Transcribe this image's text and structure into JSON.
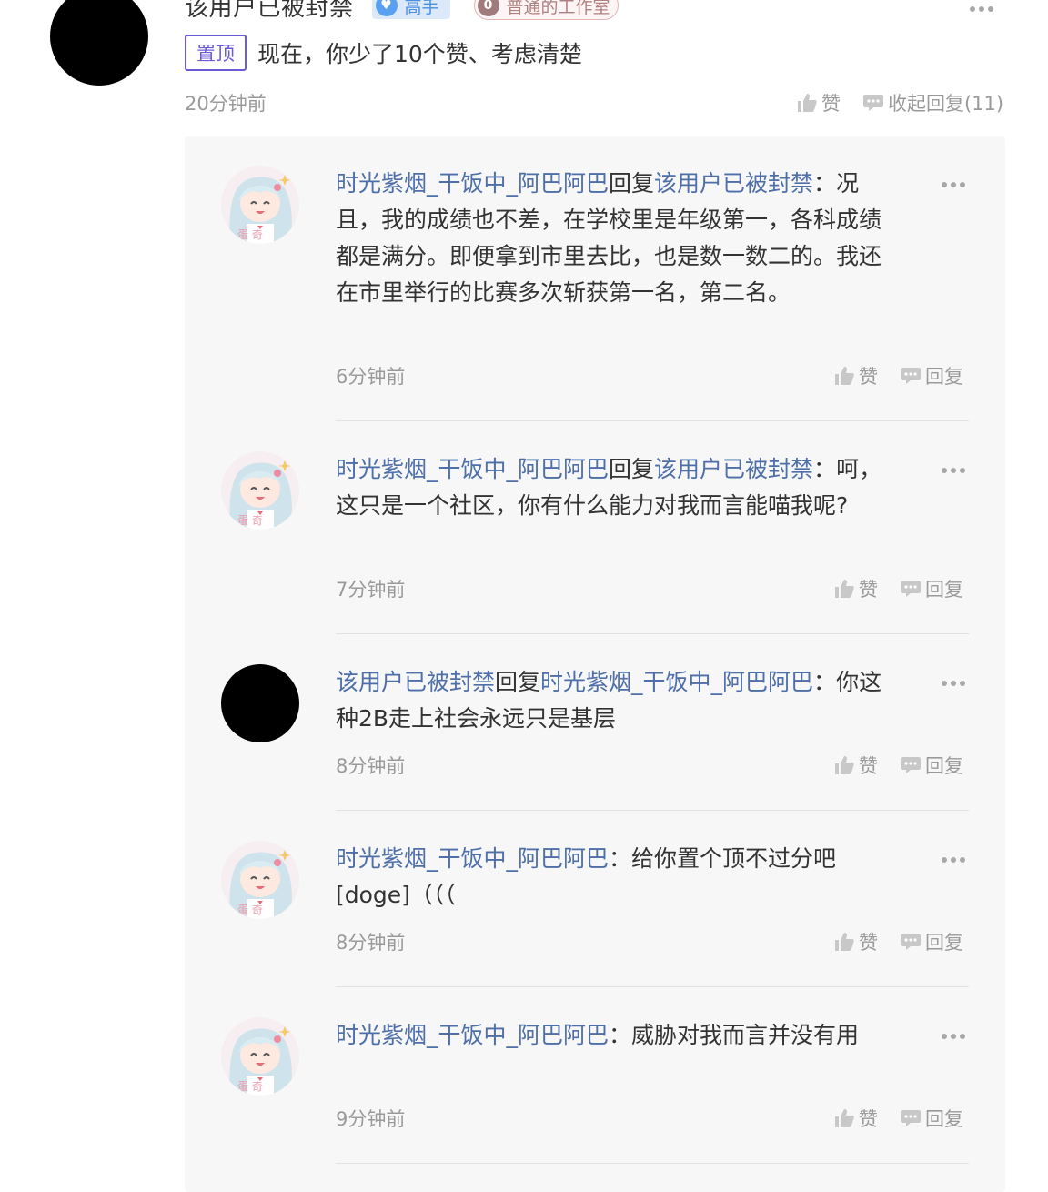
{
  "post": {
    "username": "该用户已被封禁",
    "level_badge": "高手",
    "studio_count": "0",
    "studio_name": "普通的工作室",
    "pin_label": "置顶",
    "text": "现在，你少了10个赞、考虑清楚",
    "time": "20分钟前",
    "like_label": "赞",
    "collapse_label": "收起回复(11)"
  },
  "replies": [
    {
      "author": "时光紫烟_干饭中_阿巴阿巴",
      "reply_word": "回复",
      "target": "该用户已被封禁",
      "colon": "：",
      "text": "况且，我的成绩也不差，在学校里是年级第一，各科成绩都是满分。即便拿到市里去比，也是数一数二的。我还在市里举行的比赛多次斩获第一名，第二名。",
      "time": "6分钟前",
      "like_label": "赞",
      "reply_label": "回复"
    },
    {
      "author": "时光紫烟_干饭中_阿巴阿巴",
      "reply_word": "回复",
      "target": "该用户已被封禁",
      "colon": "：",
      "text": "呵，这只是一个社区，你有什么能力对我而言能喵我呢?",
      "time": "7分钟前",
      "like_label": "赞",
      "reply_label": "回复"
    },
    {
      "author": "该用户已被封禁",
      "reply_word": "回复",
      "target": "时光紫烟_干饭中_阿巴阿巴",
      "colon": "：",
      "text": "你这种2B走上社会永远只是基层",
      "time": "8分钟前",
      "like_label": "赞",
      "reply_label": "回复"
    },
    {
      "author": "时光紫烟_干饭中_阿巴阿巴",
      "colon": "：",
      "text": "给你置个顶不过分吧[doge]（（（",
      "time": "8分钟前",
      "like_label": "赞",
      "reply_label": "回复"
    },
    {
      "author": "时光紫烟_干饭中_阿巴阿巴",
      "colon": "：",
      "text": "威胁对我而言并没有用",
      "time": "9分钟前",
      "like_label": "赞",
      "reply_label": "回复"
    }
  ],
  "icons": {
    "like": "thumbs-up-icon",
    "reply": "speech-bubble-icon",
    "more": "more-dots-icon"
  },
  "colors": {
    "link": "#4e6fa8",
    "pin": "#6c5bd6",
    "muted": "#9a9a9a"
  }
}
